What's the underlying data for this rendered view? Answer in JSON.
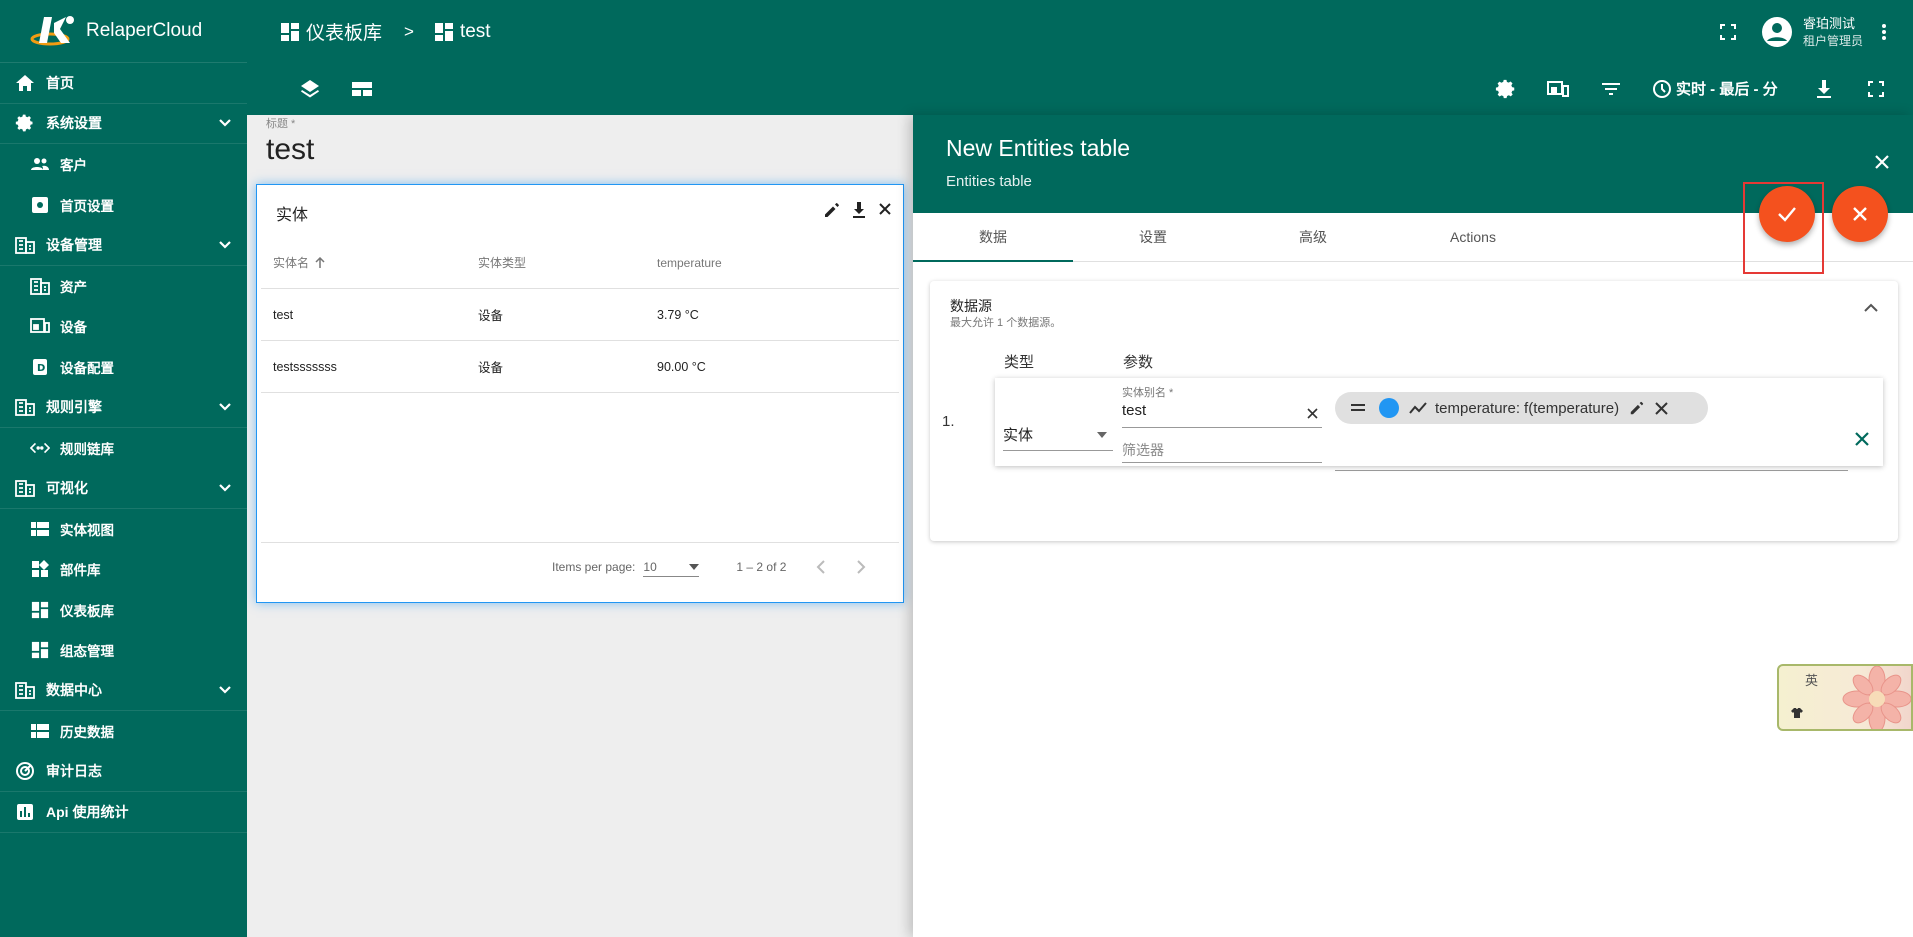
{
  "app": {
    "brand": "RelaperCloud"
  },
  "sidebar": {
    "items": [
      {
        "label": "首页",
        "icon": "home-icon",
        "sub": false
      },
      {
        "label": "系统设置",
        "icon": "gear-icon",
        "sub": false,
        "expandable": true
      },
      {
        "label": "客户",
        "icon": "users-icon",
        "sub": true
      },
      {
        "label": "首页设置",
        "icon": "settings-box-icon",
        "sub": true
      },
      {
        "label": "设备管理",
        "icon": "building-icon",
        "sub": false,
        "expandable": true
      },
      {
        "label": "资产",
        "icon": "building-icon",
        "sub": true
      },
      {
        "label": "设备",
        "icon": "device-icon",
        "sub": true
      },
      {
        "label": "设备配置",
        "icon": "profile-icon",
        "sub": true
      },
      {
        "label": "规则引擎",
        "icon": "building-icon",
        "sub": false,
        "expandable": true
      },
      {
        "label": "规则链库",
        "icon": "code-icon",
        "sub": true
      },
      {
        "label": "可视化",
        "icon": "building-icon",
        "sub": false,
        "expandable": true
      },
      {
        "label": "实体视图",
        "icon": "view-icon",
        "sub": true
      },
      {
        "label": "部件库",
        "icon": "widgets-icon",
        "sub": true
      },
      {
        "label": "仪表板库",
        "icon": "dashboard-icon",
        "sub": true
      },
      {
        "label": "组态管理",
        "icon": "dashboard-icon",
        "sub": true
      },
      {
        "label": "数据中心",
        "icon": "building-icon",
        "sub": false,
        "expandable": true
      },
      {
        "label": "历史数据",
        "icon": "view-icon",
        "sub": true
      },
      {
        "label": "审计日志",
        "icon": "track-icon",
        "sub": false
      },
      {
        "label": "Api 使用统计",
        "icon": "chart-icon",
        "sub": false
      }
    ]
  },
  "topbar": {
    "crumb_root": "仪表板库",
    "crumb_sep": ">",
    "crumb_current": "test",
    "user_name": "睿珀测试",
    "user_role": "租户管理员"
  },
  "toolbar": {
    "timewindow": "实时 - 最后 - 分"
  },
  "dashboard": {
    "title_label": "标题 *",
    "title": "test",
    "widget": {
      "title": "实体",
      "columns": [
        "实体名",
        "实体类型",
        "temperature"
      ],
      "rows": [
        [
          "test",
          "设备",
          "3.79 °C"
        ],
        [
          "testsssssss",
          "设备",
          "90.00 °C"
        ]
      ],
      "items_per_page_label": "Items per page:",
      "items_per_page": "10",
      "range": "1 – 2 of 2"
    }
  },
  "panel": {
    "title": "New Entities table",
    "subtitle": "Entities table",
    "tabs": [
      "数据",
      "设置",
      "高级",
      "Actions"
    ],
    "active_tab": 0,
    "datasource": {
      "title": "数据源",
      "hint": "最大允许 1 个数据源。",
      "col_type": "类型",
      "col_params": "参数",
      "index": "1.",
      "type_value": "实体",
      "alias_label": "实体别名 *",
      "alias_value": "test",
      "filter_placeholder": "筛选器",
      "key_chip": "temperature: ",
      "key_chip_func": "f(temperature)",
      "key_color": "#2196f3"
    }
  },
  "ime": {
    "label": "英"
  },
  "colors": {
    "primary": "#00695c",
    "accent": "#f4511e",
    "highlight": "#e53935"
  }
}
